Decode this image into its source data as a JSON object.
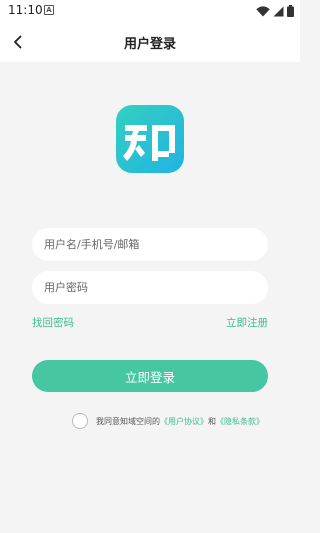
{
  "status_bar": {
    "time": "11:10",
    "notification_icon": "a-notification-icon",
    "wifi_icon": "wifi-icon",
    "signal_icon": "signal-icon",
    "battery_icon": "battery-icon"
  },
  "header": {
    "back_icon": "chevron-left-icon",
    "title": "用户登录"
  },
  "logo": {
    "glyph": "知",
    "icon": "app-logo-icon"
  },
  "form": {
    "username_placeholder": "用户名/手机号/邮箱",
    "username_value": "",
    "password_placeholder": "用户密码",
    "password_value": "",
    "forgot_password": "找回密码",
    "register": "立即注册",
    "login_button": "立即登录"
  },
  "agreement": {
    "checked": false,
    "prefix": "我同意知域空间的",
    "user_agreement": "《用户协议》",
    "and": "和",
    "privacy_policy": "《隐私条款》"
  },
  "colors": {
    "accent": "#47c7a1",
    "link": "#3cbc94",
    "logo_gradient_start": "#34d0c0",
    "logo_gradient_end": "#21b3e2",
    "background": "#f4f4f4"
  }
}
